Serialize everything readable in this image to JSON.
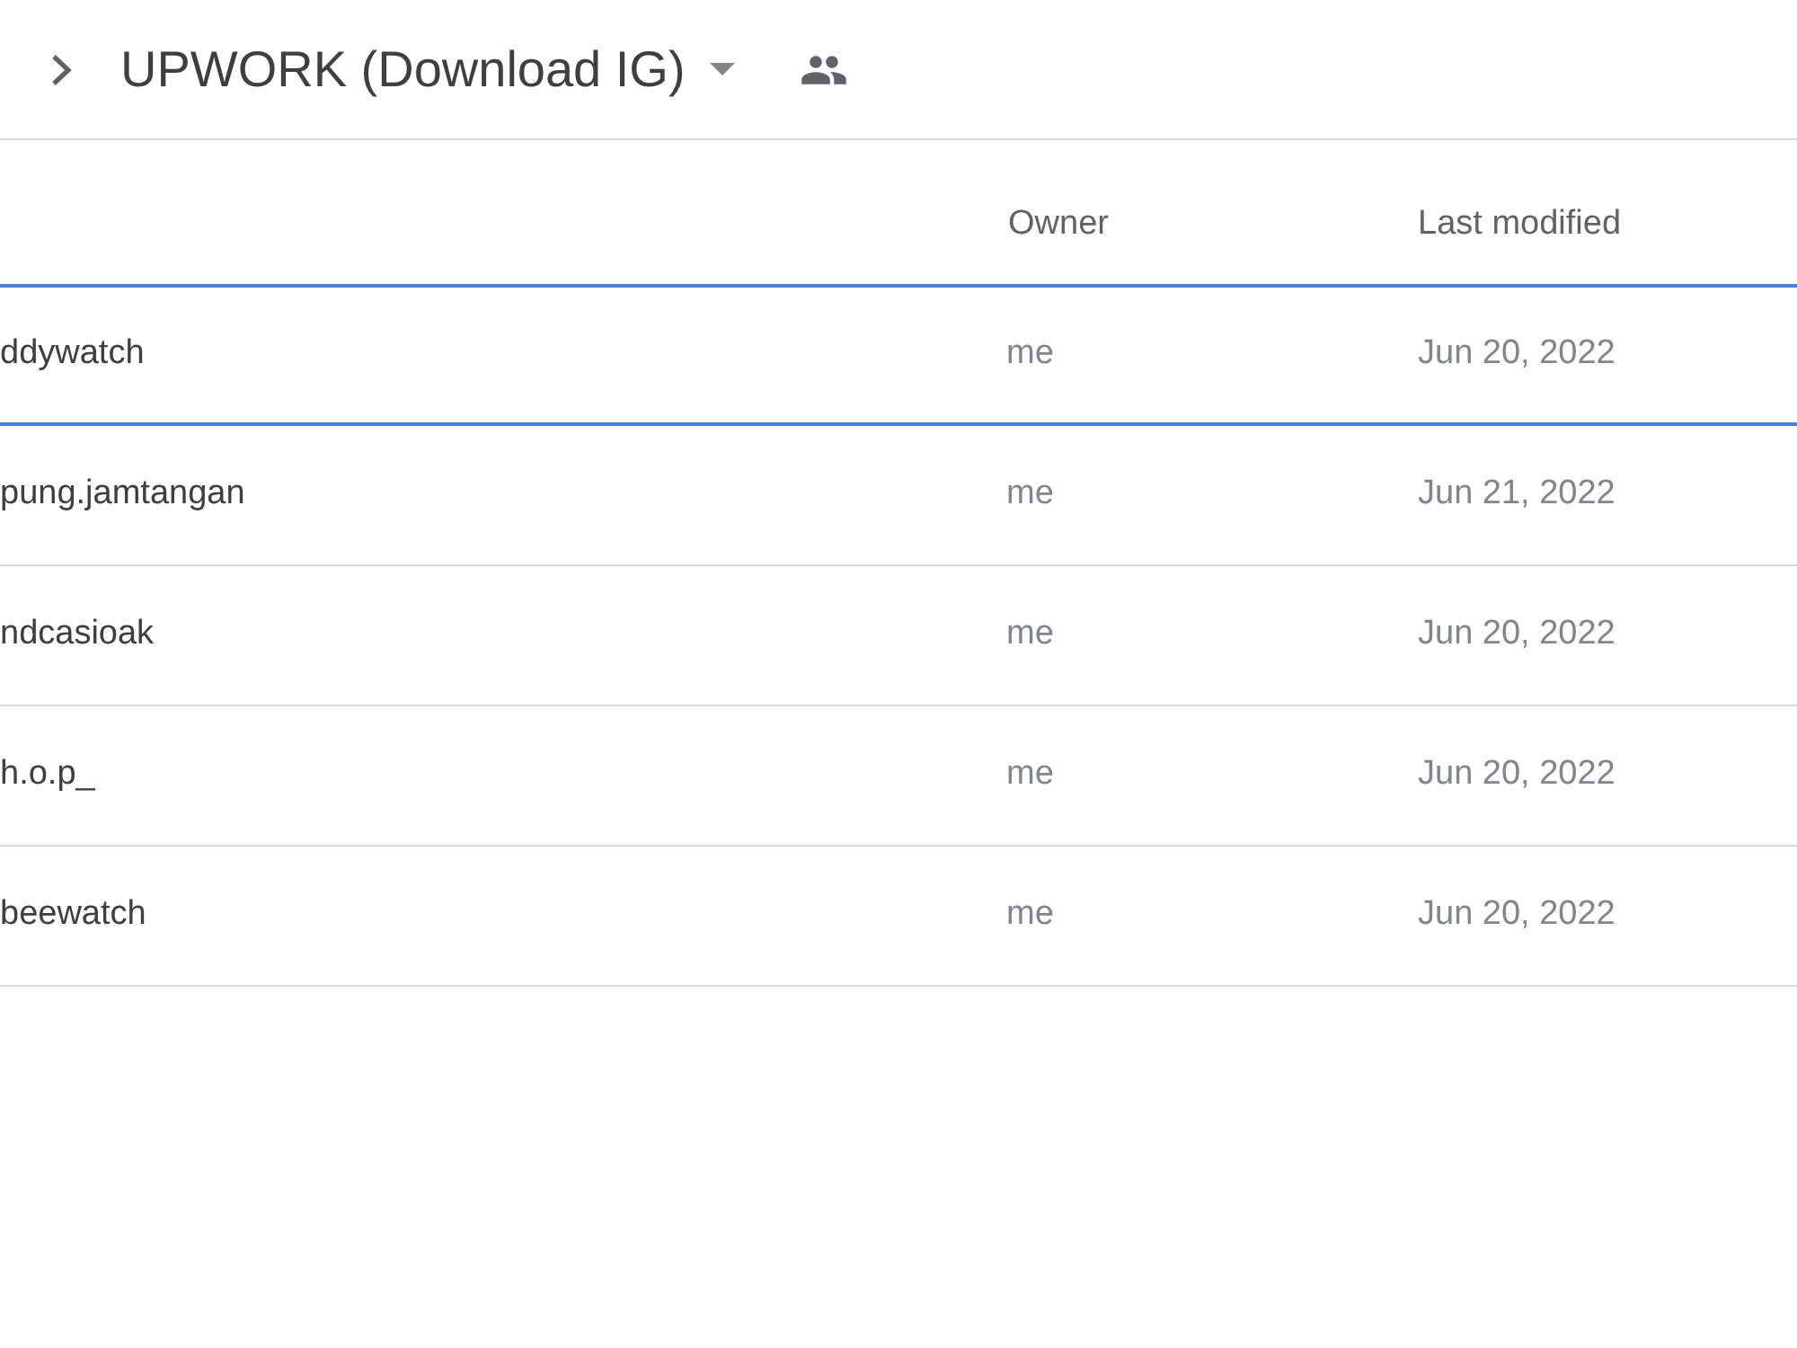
{
  "breadcrumb": {
    "title": "UPWORK (Download IG)"
  },
  "table": {
    "columns": [
      "Owner",
      "Last modified"
    ],
    "rows": [
      {
        "name": "ddywatch",
        "owner": "me",
        "last_modified": "Jun 20, 2022",
        "selected": true
      },
      {
        "name": "pung.jamtangan",
        "owner": "me",
        "last_modified": "Jun 21, 2022",
        "selected": false
      },
      {
        "name": "ndcasioak",
        "owner": "me",
        "last_modified": "Jun 20, 2022",
        "selected": false
      },
      {
        "name": "h.o.p_",
        "owner": "me",
        "last_modified": "Jun 20, 2022",
        "selected": false
      },
      {
        "name": "beewatch",
        "owner": "me",
        "last_modified": "Jun 20, 2022",
        "selected": false
      }
    ]
  }
}
